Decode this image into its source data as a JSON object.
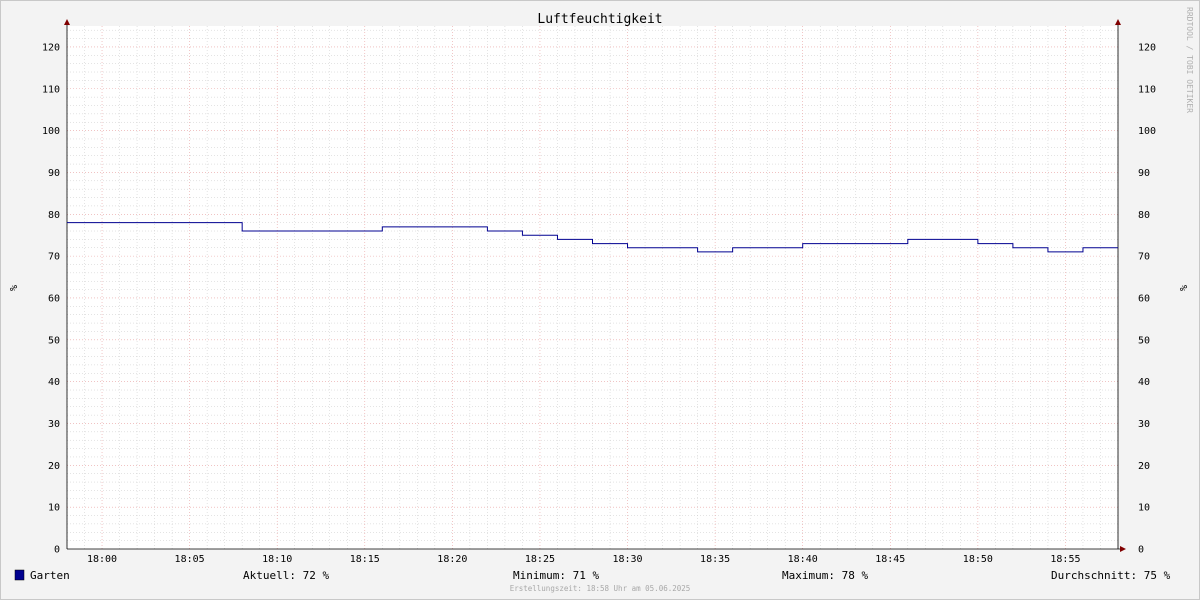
{
  "chart_data": {
    "type": "line",
    "title": "Luftfeuchtigkeit",
    "ylabel_left": "%",
    "ylabel_right": "%",
    "ylim": [
      0,
      125
    ],
    "yticks": [
      0,
      10,
      20,
      30,
      40,
      50,
      60,
      70,
      80,
      90,
      100,
      110,
      120
    ],
    "xlim_minutes": [
      1078,
      1138
    ],
    "xticks": [
      {
        "label": "18:00",
        "minute": 1080
      },
      {
        "label": "18:05",
        "minute": 1085
      },
      {
        "label": "18:10",
        "minute": 1090
      },
      {
        "label": "18:15",
        "minute": 1095
      },
      {
        "label": "18:20",
        "minute": 1100
      },
      {
        "label": "18:25",
        "minute": 1105
      },
      {
        "label": "18:30",
        "minute": 1110
      },
      {
        "label": "18:35",
        "minute": 1115
      },
      {
        "label": "18:40",
        "minute": 1120
      },
      {
        "label": "18:45",
        "minute": 1125
      },
      {
        "label": "18:50",
        "minute": 1130
      },
      {
        "label": "18:55",
        "minute": 1135
      }
    ],
    "step": true,
    "grid": true,
    "series": [
      {
        "name": "Garten",
        "color": "#000090",
        "points": [
          {
            "t": "17:58",
            "m": 1078,
            "v": 78
          },
          {
            "t": "18:08",
            "m": 1088,
            "v": 76
          },
          {
            "t": "18:16",
            "m": 1096,
            "v": 77
          },
          {
            "t": "18:22",
            "m": 1102,
            "v": 76
          },
          {
            "t": "18:24",
            "m": 1104,
            "v": 75
          },
          {
            "t": "18:26",
            "m": 1106,
            "v": 74
          },
          {
            "t": "18:28",
            "m": 1108,
            "v": 73
          },
          {
            "t": "18:30",
            "m": 1110,
            "v": 72
          },
          {
            "t": "18:34",
            "m": 1114,
            "v": 71
          },
          {
            "t": "18:36",
            "m": 1116,
            "v": 72
          },
          {
            "t": "18:40",
            "m": 1120,
            "v": 73
          },
          {
            "t": "18:46",
            "m": 1126,
            "v": 74
          },
          {
            "t": "18:50",
            "m": 1130,
            "v": 73
          },
          {
            "t": "18:52",
            "m": 1132,
            "v": 72
          },
          {
            "t": "18:54",
            "m": 1134,
            "v": 71
          },
          {
            "t": "18:56",
            "m": 1136,
            "v": 72
          },
          {
            "t": "18:58",
            "m": 1138,
            "v": 72
          }
        ]
      }
    ]
  },
  "watermark": "RRDTOOL / TOBI OETIKER",
  "legend": {
    "series_name": "Garten",
    "swatch_color": "#000090",
    "current": "Aktuell:  72 %",
    "minimum": "Minimum:  71 %",
    "maximum": "Maximum:  78 %",
    "average": "Durchschnitt:  75 %"
  },
  "footer": "Erstellungszeit: 18:58 Uhr am 05.06.2025",
  "colors": {
    "background": "#f3f3f3",
    "plot": "#ffffff",
    "major_grid": "#e8a0a0",
    "minor_grid": "#c8c8c8",
    "axis": "#000000",
    "arrow": "#800000"
  }
}
